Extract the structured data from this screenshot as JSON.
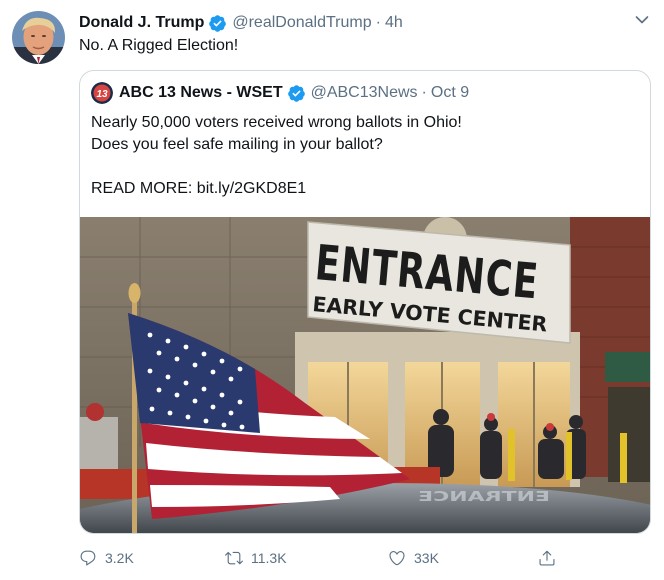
{
  "tweet": {
    "author_name": "Donald J. Trump",
    "author_handle": "@realDonaldTrump",
    "separator": "·",
    "time": "4h",
    "text": "No. A Rigged Election!"
  },
  "quoted_tweet": {
    "author_name": "ABC 13 News - WSET",
    "author_handle": "@ABC13News",
    "separator": "·",
    "date": "Oct 9",
    "text_lines": [
      "Nearly 50,000 voters received wrong ballots in Ohio!",
      "Does you feel safe mailing in your ballot?",
      "",
      "READ MORE: bit.ly/2GKD8E1"
    ],
    "avatar_label": "13",
    "media": {
      "sign_line_1": "ENTRANCE",
      "sign_line_2": "EARLY VOTE CENTER",
      "car_reflection_text": "ENTRANCE"
    }
  },
  "actions": {
    "reply_count": "3.2K",
    "retweet_count": "11.3K",
    "like_count": "33K"
  },
  "colors": {
    "verified_blue": "#1d9bf0",
    "secondary_text": "#5b7083",
    "border": "#cfd9de"
  },
  "icons": [
    "verified-badge-icon",
    "chevron-down-icon",
    "reply-icon",
    "retweet-icon",
    "like-icon",
    "share-icon"
  ]
}
